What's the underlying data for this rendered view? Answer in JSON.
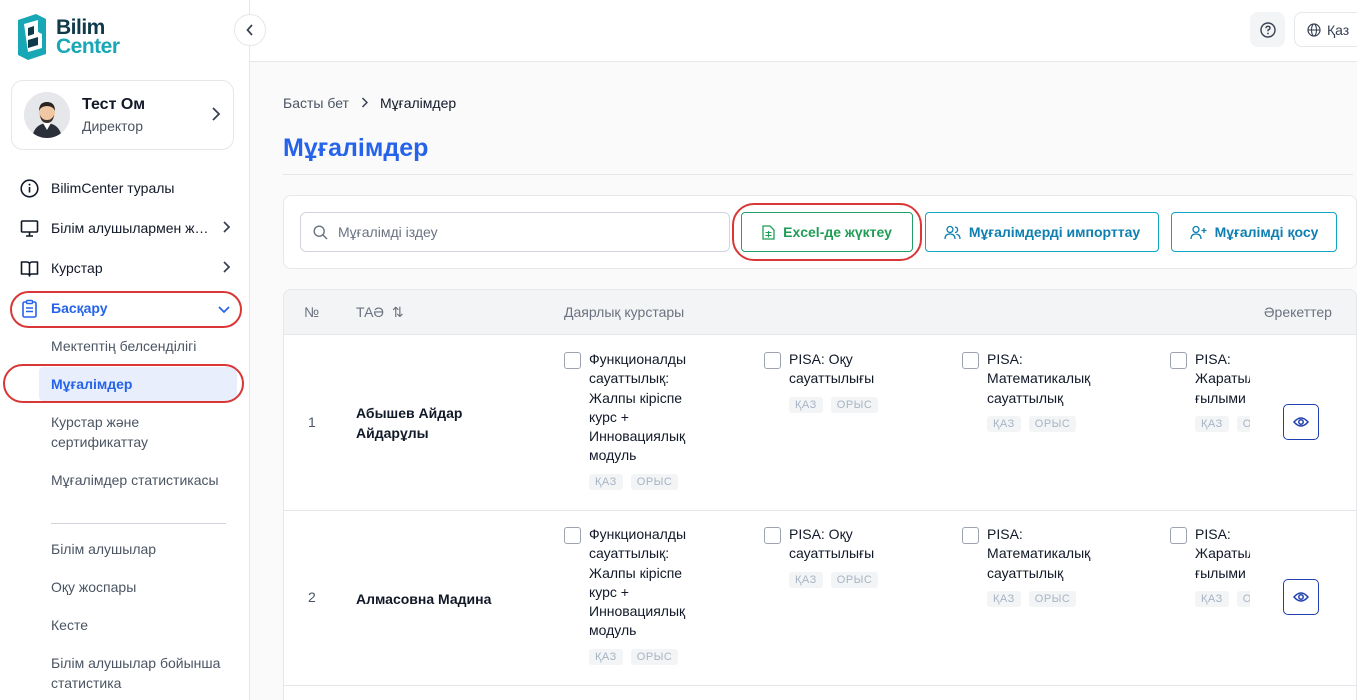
{
  "app": {
    "logo_line1": "Bilim",
    "logo_line2": "Center"
  },
  "user": {
    "name": "Тест Ом",
    "role": "Директор"
  },
  "sidebar": {
    "items": [
      {
        "label": "BilimCenter туралы",
        "icon": "info-icon"
      },
      {
        "label": "Білім алушылармен жұмыс",
        "icon": "monitor-icon"
      },
      {
        "label": "Курстар",
        "icon": "book-icon"
      },
      {
        "label": "Басқару",
        "icon": "clipboard-icon"
      }
    ],
    "sub_items": [
      "Мектептің белсенділігі",
      "Мұғалімдер",
      "Курстар және сертификаттау",
      "Мұғалімдер статистикасы",
      "Білім алушылар",
      "Оқу жоспары",
      "Кесте",
      "Білім алушылар бойынша статистика"
    ]
  },
  "topbar": {
    "language": "Қаз",
    "help_icon": "question-circle-icon"
  },
  "breadcrumb": {
    "home": "Басты бет",
    "current": "Мұғалімдер"
  },
  "page": {
    "title": "Мұғалімдер"
  },
  "toolbar": {
    "search_placeholder": "Мұғалімді іздеу",
    "excel_label": "Excel-де жүктеу",
    "import_label": "Мұғалімдерді импорттау",
    "add_label": "Мұғалімді қосу"
  },
  "table": {
    "headers": {
      "num": "№",
      "name": "ТАӘ",
      "sort_icon": "⇅",
      "courses": "Даярлық курстары",
      "actions": "Әрекеттер"
    },
    "rows": [
      {
        "num": "1",
        "name": "Абышев Айдар Айдарұлы",
        "courses": [
          {
            "text": "Функционалды сауаттылық: Жалпы кіріспе курс + Инновациялық модуль",
            "tags": [
              "ҚАЗ",
              "ОРЫС"
            ]
          },
          {
            "text": "PISA: Оқу сауаттылығы",
            "tags": [
              "ҚАЗ",
              "ОРЫС"
            ]
          },
          {
            "text": "PISA: Математикалық сауаттылық",
            "tags": [
              "ҚАЗ",
              "ОРЫС"
            ]
          },
          {
            "text": "PISA: Жаратылыстану ғылыми",
            "tags": [
              "ҚАЗ",
              "ОРЫС"
            ]
          }
        ]
      },
      {
        "num": "2",
        "name": "Алмасовна Мадина",
        "courses": [
          {
            "text": "Функционалды сауаттылық: Жалпы кіріспе курс + Инновациялық модуль",
            "tags": [
              "ҚАЗ",
              "ОРЫС"
            ]
          },
          {
            "text": "PISA: Оқу сауаттылығы",
            "tags": [
              "ҚАЗ",
              "ОРЫС"
            ]
          },
          {
            "text": "PISA: Математикалық сауаттылық",
            "tags": [
              "ҚАЗ",
              "ОРЫС"
            ]
          },
          {
            "text": "PISA: Жаратылыстану ғылыми",
            "tags": [
              "ҚАЗ",
              "ОРЫС"
            ]
          }
        ]
      }
    ]
  },
  "colors": {
    "primary": "#2563eb",
    "excel_green": "#1f9d55",
    "accent_teal": "#0ea5c6",
    "highlight_ring": "#d93636"
  }
}
